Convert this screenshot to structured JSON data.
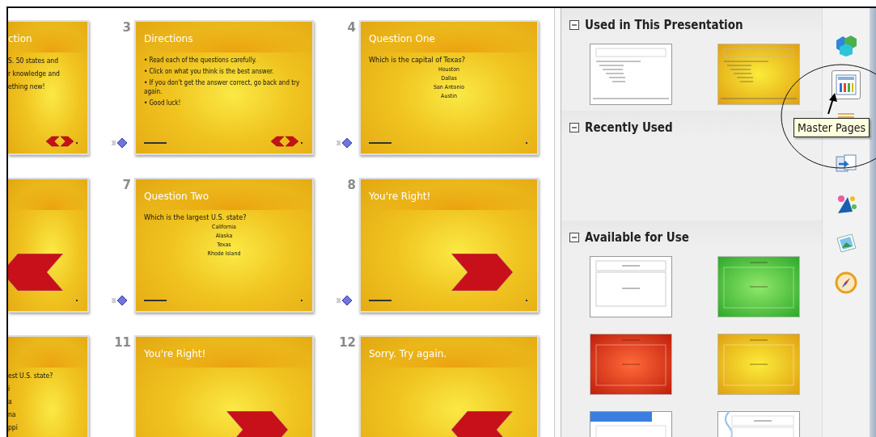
{
  "slide_rows": [
    {
      "slides": [
        {
          "title": "ction",
          "body": [
            {
              "kind": "text",
              "text": "S. 50 states and"
            },
            {
              "kind": "text",
              "text": "r knowledge and"
            },
            {
              "kind": "text",
              "text": "ething new!"
            }
          ],
          "kind": "double-arrows"
        },
        {
          "number": "3",
          "title": "Directions",
          "body": [
            {
              "kind": "bullet",
              "text": "• Read each of the questions carefully."
            },
            {
              "kind": "bullet",
              "text": "• Click on what you think is the best answer."
            },
            {
              "kind": "bullet",
              "text": "• If you don't get the answer correct, go back and try again."
            },
            {
              "kind": "bullet",
              "text": "• Good luck!"
            }
          ],
          "kind": "double-arrows",
          "transition": true
        },
        {
          "number": "4",
          "title": "Question One",
          "body": [
            {
              "kind": "question",
              "text": "Which is the capital of Texas?"
            },
            {
              "kind": "option",
              "text": "Houston"
            },
            {
              "kind": "option",
              "text": "Dallas"
            },
            {
              "kind": "option",
              "text": "San Antonio"
            },
            {
              "kind": "option",
              "text": "Austin"
            }
          ],
          "kind": "plain",
          "transition": true
        }
      ]
    },
    {
      "slides": [
        {
          "kind": "left-arrow"
        },
        {
          "number": "7",
          "title": "Question Two",
          "body": [
            {
              "kind": "question",
              "text": "Which is the largest U.S. state?"
            },
            {
              "kind": "option",
              "text": "California"
            },
            {
              "kind": "option",
              "text": "Alaska"
            },
            {
              "kind": "option",
              "text": "Texas"
            },
            {
              "kind": "option",
              "text": "Rhode Island"
            }
          ],
          "kind": "plain",
          "transition": true
        },
        {
          "number": "8",
          "title": "You're Right!",
          "kind": "right-arrow",
          "transition": true
        }
      ]
    },
    {
      "slides": [
        {
          "body": [
            {
              "kind": "text",
              "text": "est U.S. state?"
            },
            {
              "kind": "text",
              "text": "i"
            },
            {
              "kind": "text",
              "text": "a"
            },
            {
              "kind": "text",
              "text": "na"
            },
            {
              "kind": "text",
              "text": "ppi"
            }
          ],
          "kind": "plain"
        },
        {
          "number": "11",
          "title": "You're Right!",
          "kind": "right-arrow",
          "transition": false
        },
        {
          "number": "12",
          "title": "Sorry. Try again.",
          "kind": "left-arrow",
          "transition": false
        }
      ]
    }
  ],
  "panel": {
    "sections": [
      {
        "title": "Used in This Presentation",
        "expanded": true,
        "masters": [
          {
            "kind": "white"
          },
          {
            "kind": "gold"
          }
        ]
      },
      {
        "title": "Recently Used",
        "expanded": true
      },
      {
        "title": "Available for Use",
        "expanded": true,
        "masters": [
          {
            "kind": "plain"
          },
          {
            "kind": "green"
          },
          {
            "kind": "red"
          },
          {
            "kind": "yellow"
          },
          {
            "kind": "blue-header"
          },
          {
            "kind": "wave"
          }
        ]
      }
    ]
  },
  "sidebar": {
    "icons": [
      {
        "kind": "properties",
        "selected": false
      },
      {
        "kind": "master-pages",
        "selected": true
      },
      {
        "kind": "layouts",
        "selected": false
      },
      {
        "kind": "transition",
        "selected": false
      },
      {
        "kind": "animation",
        "selected": false
      },
      {
        "kind": "gallery",
        "selected": false
      },
      {
        "kind": "navigator",
        "selected": false
      }
    ]
  },
  "tooltip": {
    "text": "Master Pages"
  }
}
